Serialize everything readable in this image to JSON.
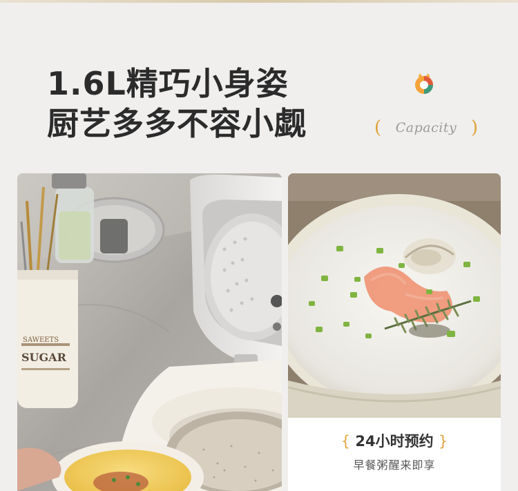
{
  "headline": {
    "line1": "1.6L精巧小身姿",
    "line2": "厨艺多多不容小觑"
  },
  "capacity": {
    "open": "(",
    "label": "Capacity",
    "close": ")"
  },
  "left_photo": {
    "sugar_label": "SUGAR",
    "jar_top_text": "SAWEETS"
  },
  "feature": {
    "open": "{",
    "title": "24小时预约",
    "close": "}",
    "subtitle": "早餐粥醒来即享"
  },
  "colors": {
    "background": "#f0efee",
    "accent": "#e0a23a",
    "headline": "#2b2b2b"
  }
}
